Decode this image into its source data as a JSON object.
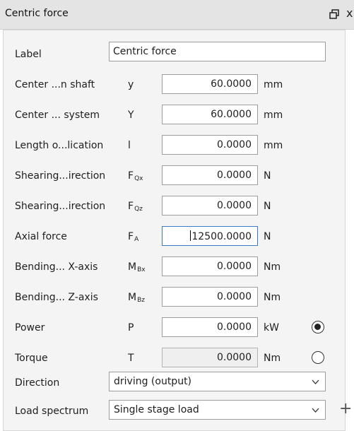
{
  "window": {
    "title": "Centric force",
    "close_glyph": "x"
  },
  "label_row": {
    "label": "Label",
    "value": "Centric force"
  },
  "rows": [
    {
      "label": "Center ...n shaft",
      "symbol": "y",
      "sub": "",
      "value": "60.0000",
      "unit": "mm"
    },
    {
      "label": "Center ... system",
      "symbol": "Y",
      "sub": "",
      "value": "60.0000",
      "unit": "mm"
    },
    {
      "label": "Length o...lication",
      "symbol": "l",
      "sub": "",
      "value": "0.0000",
      "unit": "mm"
    },
    {
      "label": "Shearing...irection",
      "symbol": "F",
      "sub": "Qx",
      "value": "0.0000",
      "unit": "N"
    },
    {
      "label": "Shearing...irection",
      "symbol": "F",
      "sub": "Qz",
      "value": "0.0000",
      "unit": "N"
    },
    {
      "label": "Axial force",
      "symbol": "F",
      "sub": "A",
      "value": "12500.0000",
      "unit": "N"
    },
    {
      "label": "Bending... X-axis",
      "symbol": "M",
      "sub": "Bx",
      "value": "0.0000",
      "unit": "Nm"
    },
    {
      "label": "Bending... Z-axis",
      "symbol": "M",
      "sub": "Bz",
      "value": "0.0000",
      "unit": "Nm"
    },
    {
      "label": "Power",
      "symbol": "P",
      "sub": "",
      "value": "0.0000",
      "unit": "kW",
      "selected": true
    },
    {
      "label": "Torque",
      "symbol": "T",
      "sub": "",
      "value": "0.0000",
      "unit": "Nm",
      "selected": false
    }
  ],
  "direction": {
    "label": "Direction",
    "value": "driving (output)"
  },
  "load_spectrum": {
    "label": "Load spectrum",
    "value": "Single stage load",
    "add_glyph": "+"
  },
  "colors": {
    "focus_border": "#3b7ac9",
    "titlebar_bg": "#e4e4e4",
    "panel_bg": "#f4f4f4"
  }
}
